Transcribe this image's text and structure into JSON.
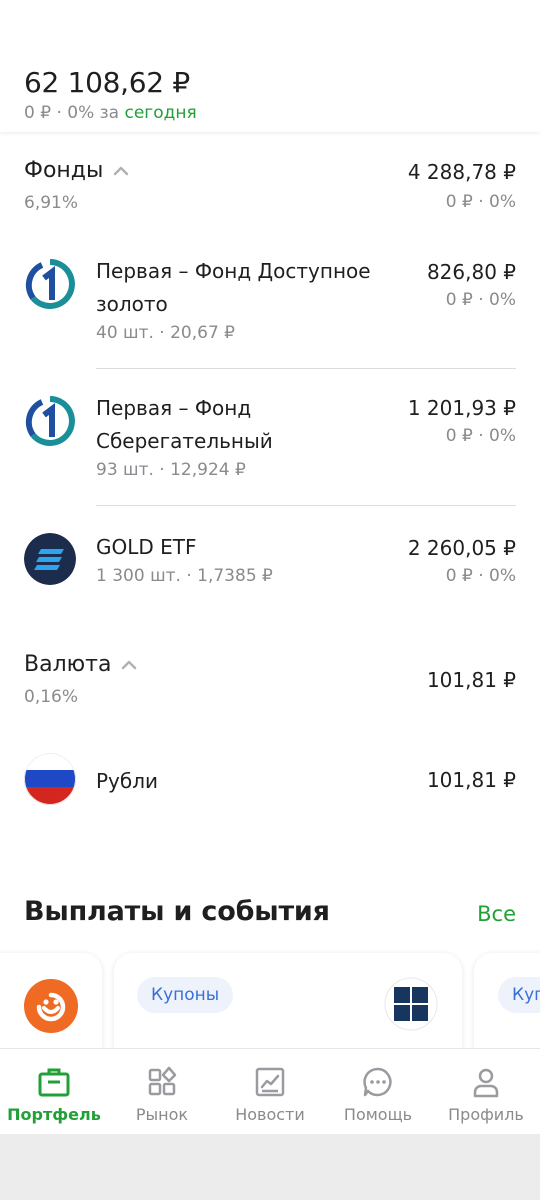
{
  "portfolio": {
    "total": "62 108,62 ₽",
    "change_prefix": "0 ₽ · 0% за ",
    "change_link": "сегодня"
  },
  "funds": {
    "title": "Фонды",
    "pct": "6,91%",
    "value": "4 288,78 ₽",
    "change": "0 ₽ · 0%",
    "items": [
      {
        "name": "Первая – Фонд Доступное золото",
        "qty": "40 шт. · 20,67 ₽",
        "value": "826,80 ₽",
        "change": "0 ₽ · 0%",
        "logo": "pervaya-logo-icon"
      },
      {
        "name": "Первая – Фонд Сберегательный",
        "qty": "93 шт. · 12,924 ₽",
        "value": "1 201,93 ₽",
        "change": "0 ₽ · 0%",
        "logo": "pervaya-logo-icon"
      },
      {
        "name": "GOLD ETF",
        "qty": "1 300 шт. · 1,7385 ₽",
        "value": "2 260,05 ₽",
        "change": "0 ₽ · 0%",
        "logo": "fund-stripes-icon"
      }
    ]
  },
  "currency": {
    "title": "Валюта",
    "pct": "0,16%",
    "value": "101,81 ₽",
    "items": [
      {
        "name": "Рубли",
        "value": "101,81 ₽",
        "logo": "russia-flag-icon"
      }
    ]
  },
  "events": {
    "title": "Выплаты и события",
    "all_label": "Все",
    "cards": [
      {
        "chip": "",
        "logo": "orange-smile-icon"
      },
      {
        "chip": "Купоны",
        "logo": "windows-logo-icon"
      },
      {
        "chip": "Куп"
      }
    ]
  },
  "nav": {
    "items": [
      {
        "label": "Портфель",
        "icon": "briefcase-icon",
        "active": true
      },
      {
        "label": "Рынок",
        "icon": "market-grid-icon"
      },
      {
        "label": "Новости",
        "icon": "news-chart-icon"
      },
      {
        "label": "Помощь",
        "icon": "chat-help-icon"
      },
      {
        "label": "Профиль",
        "icon": "profile-icon"
      }
    ]
  },
  "colors": {
    "accent_green": "#21a038",
    "chip_blue": "#3a6fd8",
    "muted": "#8a8a8f"
  }
}
